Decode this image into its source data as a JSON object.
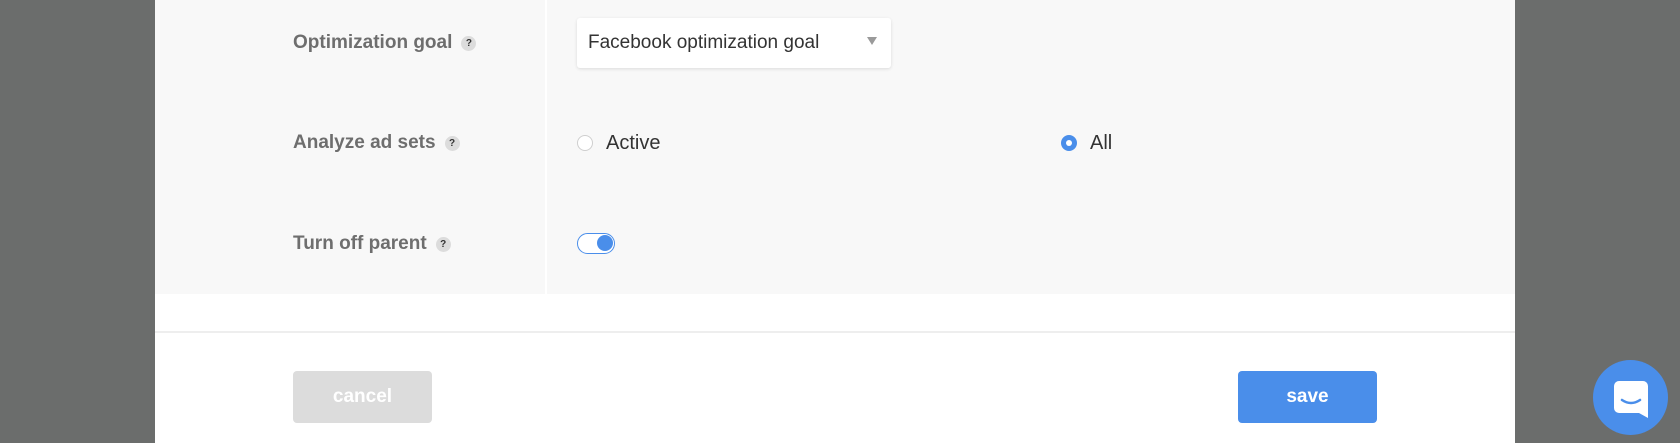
{
  "settings": {
    "rows": [
      {
        "label": "Optimization goal",
        "help": "?"
      },
      {
        "label": "Analyze ad sets",
        "help": "?"
      },
      {
        "label": "Turn off parent",
        "help": "?"
      }
    ],
    "optimization_goal": {
      "selected": "Facebook optimization goal"
    },
    "analyze_ad_sets": {
      "options": [
        {
          "label": "Active",
          "checked": false
        },
        {
          "label": "All",
          "checked": true
        }
      ]
    },
    "turn_off_parent": {
      "on": true
    }
  },
  "footer": {
    "cancel_label": "cancel",
    "save_label": "save"
  },
  "colors": {
    "accent": "#4a8eea",
    "backdrop": "#6b6d6c",
    "panel": "#f8f8f8",
    "disabled_button": "#dcdcdc"
  },
  "icons": {
    "help": "help-icon",
    "dropdown": "chevron-down-icon",
    "chat": "chat-icon"
  }
}
